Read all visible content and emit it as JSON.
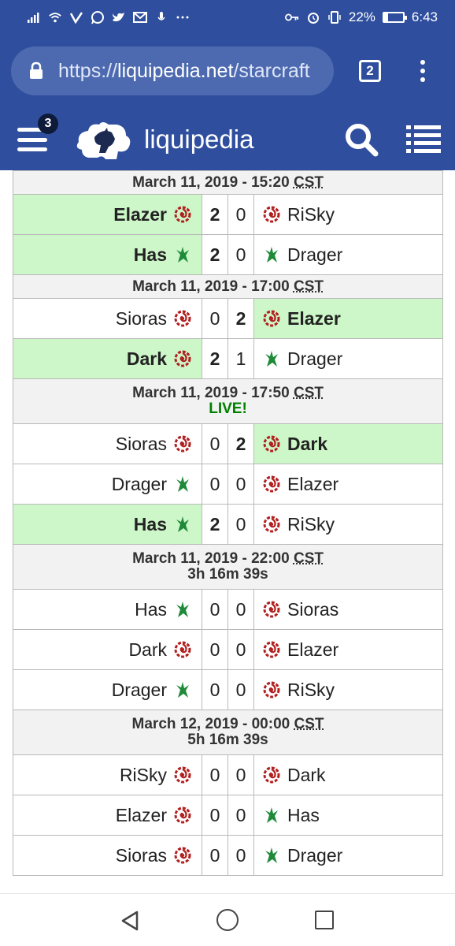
{
  "statusbar": {
    "battery": "22%",
    "time": "6:43",
    "left_icons": [
      "signal-icon",
      "wifi-icon",
      "vpn-icon",
      "whatsapp-icon",
      "twitter-icon",
      "gmail-icon",
      "mic-icon",
      "more-icon"
    ],
    "right_icons": [
      "key-icon",
      "alarm-icon",
      "vibrate-icon",
      "battery-icon"
    ]
  },
  "browser": {
    "url_scheme": "https://",
    "url_host": "liquipedia.net",
    "url_path": "/starcraft",
    "tab_count": "2"
  },
  "site": {
    "brand": "liquipedia",
    "notification_count": "3"
  },
  "schedule": [
    {
      "datetime": "March 11, 2019 - 15:20",
      "timezone": "CST",
      "status": "",
      "matches": [
        {
          "p1": "Elazer",
          "r1": "zerg",
          "s1": "2",
          "s2": "0",
          "p2": "RiSky",
          "r2": "zerg",
          "winner": 1
        },
        {
          "p1": "Has",
          "r1": "protoss",
          "s1": "2",
          "s2": "0",
          "p2": "Drager",
          "r2": "protoss",
          "winner": 1
        }
      ]
    },
    {
      "datetime": "March 11, 2019 - 17:00",
      "timezone": "CST",
      "status": "",
      "matches": [
        {
          "p1": "Sioras",
          "r1": "zerg",
          "s1": "0",
          "s2": "2",
          "p2": "Elazer",
          "r2": "zerg",
          "winner": 2
        },
        {
          "p1": "Dark",
          "r1": "zerg",
          "s1": "2",
          "s2": "1",
          "p2": "Drager",
          "r2": "protoss",
          "winner": 1
        }
      ]
    },
    {
      "datetime": "March 11, 2019 - 17:50",
      "timezone": "CST",
      "status": "LIVE!",
      "matches": [
        {
          "p1": "Sioras",
          "r1": "zerg",
          "s1": "0",
          "s2": "2",
          "p2": "Dark",
          "r2": "zerg",
          "winner": 2
        },
        {
          "p1": "Drager",
          "r1": "protoss",
          "s1": "0",
          "s2": "0",
          "p2": "Elazer",
          "r2": "zerg",
          "winner": 0
        },
        {
          "p1": "Has",
          "r1": "protoss",
          "s1": "2",
          "s2": "0",
          "p2": "RiSky",
          "r2": "zerg",
          "winner": 1
        }
      ]
    },
    {
      "datetime": "March 11, 2019 - 22:00",
      "timezone": "CST",
      "status": "3h 16m 39s",
      "matches": [
        {
          "p1": "Has",
          "r1": "protoss",
          "s1": "0",
          "s2": "0",
          "p2": "Sioras",
          "r2": "zerg",
          "winner": 0
        },
        {
          "p1": "Dark",
          "r1": "zerg",
          "s1": "0",
          "s2": "0",
          "p2": "Elazer",
          "r2": "zerg",
          "winner": 0
        },
        {
          "p1": "Drager",
          "r1": "protoss",
          "s1": "0",
          "s2": "0",
          "p2": "RiSky",
          "r2": "zerg",
          "winner": 0
        }
      ]
    },
    {
      "datetime": "March 12, 2019 - 00:00",
      "timezone": "CST",
      "status": "5h 16m 39s",
      "matches": [
        {
          "p1": "RiSky",
          "r1": "zerg",
          "s1": "0",
          "s2": "0",
          "p2": "Dark",
          "r2": "zerg",
          "winner": 0
        },
        {
          "p1": "Elazer",
          "r1": "zerg",
          "s1": "0",
          "s2": "0",
          "p2": "Has",
          "r2": "protoss",
          "winner": 0
        },
        {
          "p1": "Sioras",
          "r1": "zerg",
          "s1": "0",
          "s2": "0",
          "p2": "Drager",
          "r2": "protoss",
          "winner": 0
        }
      ]
    }
  ],
  "colors": {
    "header_blue": "#2f4f9e",
    "winner_green": "#cdf7c8",
    "live_green": "#008000",
    "zerg_red": "#b21f1f",
    "protoss_green": "#1f8a3a"
  },
  "navbar": {
    "icons": [
      "back-icon",
      "home-icon",
      "recent-apps-icon"
    ]
  }
}
